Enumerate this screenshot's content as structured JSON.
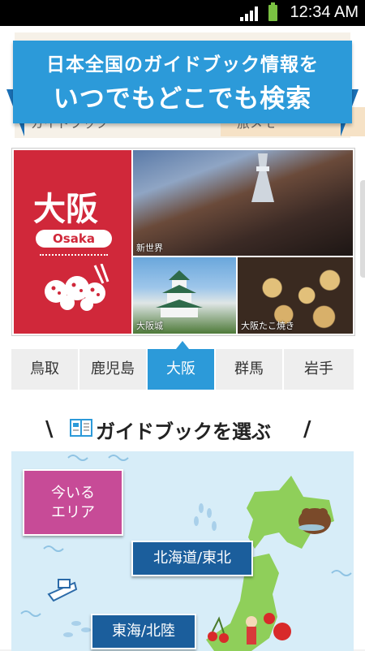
{
  "status": {
    "time": "12:34 AM",
    "battery_color": "#7ac142"
  },
  "banner": {
    "line1": "日本全国のガイドブック情報を",
    "line2": "いつでもどこでも検索"
  },
  "behind_tabs": {
    "left": "ガイドブック",
    "right": "旅メモ"
  },
  "hero": {
    "city_name": "大阪",
    "city_roman": "Osaka",
    "photo_captions": [
      "新世界",
      "大阪城",
      "大阪たこ焼き"
    ]
  },
  "city_tabs": [
    {
      "label": "鳥取",
      "active": false
    },
    {
      "label": "鹿児島",
      "active": false
    },
    {
      "label": "大阪",
      "active": true
    },
    {
      "label": "群馬",
      "active": false
    },
    {
      "label": "岩手",
      "active": false
    }
  ],
  "section": {
    "title": "ガイドブックを選ぶ"
  },
  "map": {
    "current_area_line1": "今いる",
    "current_area_line2": "エリア",
    "regions": [
      "北海道/東北",
      "東海/北陸"
    ]
  },
  "colors": {
    "accent_blue": "#2c9ad9",
    "osaka_red": "#d0283a",
    "area_button": "#c74b97",
    "region_button": "#1b5e9c"
  }
}
